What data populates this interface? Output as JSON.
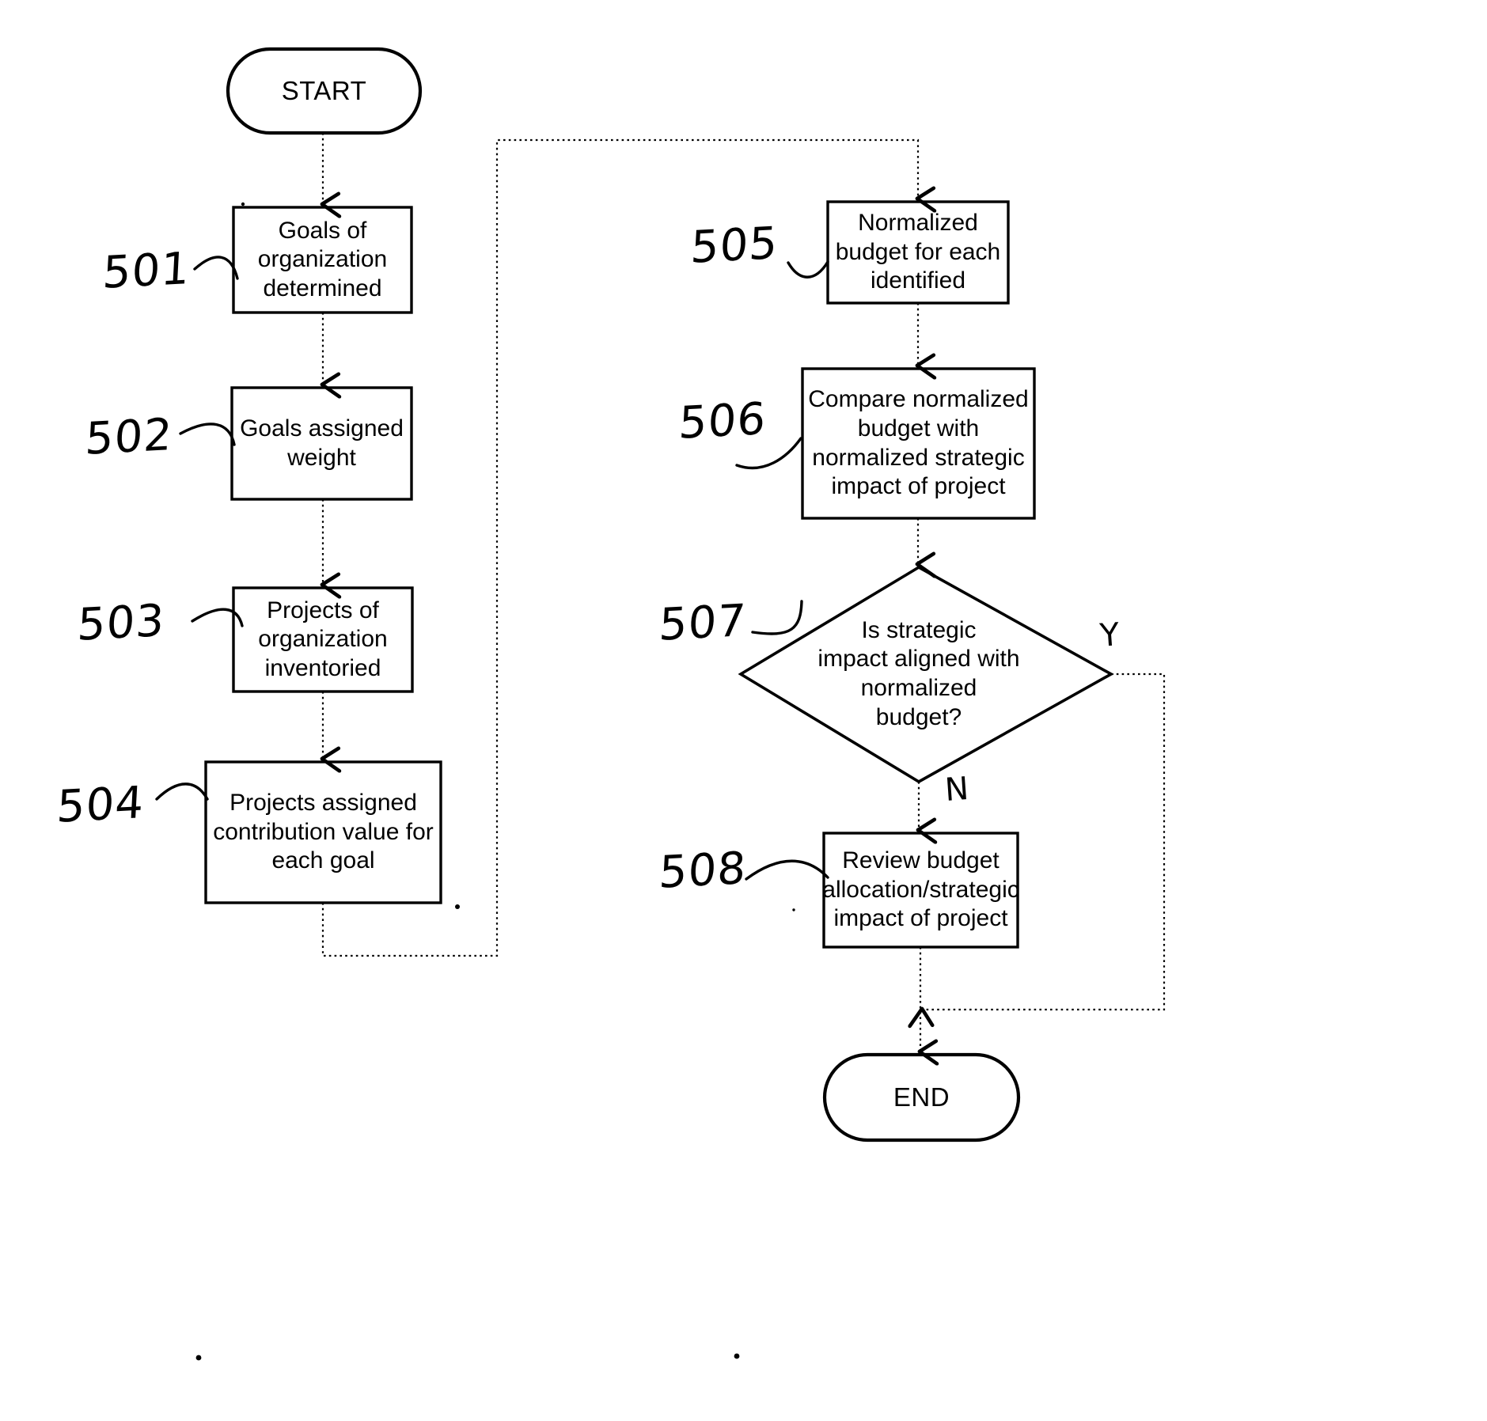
{
  "figure": {
    "type": "flowchart",
    "orientation": "two-column",
    "background_color": "#ffffff",
    "line_color": "#000000"
  },
  "nodes": {
    "start": {
      "label": "START",
      "shape": "terminator"
    },
    "n501": {
      "label": "Goals of\norganization\ndetermined",
      "shape": "process",
      "ref": "501"
    },
    "n502": {
      "label": "Goals assigned\nweight",
      "shape": "process",
      "ref": "502"
    },
    "n503": {
      "label": "Projects of\norganization\ninventoried",
      "shape": "process",
      "ref": "503"
    },
    "n504": {
      "label": "Projects assigned\ncontribution value for\neach goal",
      "shape": "process",
      "ref": "504"
    },
    "n505": {
      "label": "Normalized\nbudget for each\nidentified",
      "shape": "process",
      "ref": "505"
    },
    "n506": {
      "label": "Compare normalized\nbudget with\nnormalized strategic\nimpact of project",
      "shape": "process",
      "ref": "506"
    },
    "n507": {
      "label": "Is strategic\nimpact aligned with\nnormalized\nbudget?",
      "shape": "decision",
      "ref": "507"
    },
    "n508": {
      "label": "Review budget\nallocation/strategic\nimpact of project",
      "shape": "process",
      "ref": "508"
    },
    "end": {
      "label": "END",
      "shape": "terminator"
    }
  },
  "reference_numerals": {
    "r501": "501",
    "r502": "502",
    "r503": "503",
    "r504": "504",
    "r505": "505",
    "r506": "506",
    "r507": "507",
    "r508": "508"
  },
  "branch_labels": {
    "yes": "Y",
    "no": "N"
  },
  "chart_data": {
    "type": "diagram",
    "title": "",
    "nodes": [
      {
        "id": "start",
        "text": "START",
        "shape": "terminator",
        "ref": null
      },
      {
        "id": "501",
        "text": "Goals of organization determined",
        "shape": "process",
        "ref": "501"
      },
      {
        "id": "502",
        "text": "Goals assigned weight",
        "shape": "process",
        "ref": "502"
      },
      {
        "id": "503",
        "text": "Projects of organization inventoried",
        "shape": "process",
        "ref": "503"
      },
      {
        "id": "504",
        "text": "Projects assigned contribution value for each goal",
        "shape": "process",
        "ref": "504"
      },
      {
        "id": "505",
        "text": "Normalized budget for each identified",
        "shape": "process",
        "ref": "505"
      },
      {
        "id": "506",
        "text": "Compare normalized budget with normalized strategic impact of project",
        "shape": "process",
        "ref": "506"
      },
      {
        "id": "507",
        "text": "Is strategic impact aligned with normalized budget?",
        "shape": "decision",
        "ref": "507"
      },
      {
        "id": "508",
        "text": "Review budget allocation/strategic impact of project",
        "shape": "process",
        "ref": "508"
      },
      {
        "id": "end",
        "text": "END",
        "shape": "terminator",
        "ref": null
      }
    ],
    "edges": [
      {
        "from": "start",
        "to": "501",
        "label": ""
      },
      {
        "from": "501",
        "to": "502",
        "label": ""
      },
      {
        "from": "502",
        "to": "503",
        "label": ""
      },
      {
        "from": "503",
        "to": "504",
        "label": ""
      },
      {
        "from": "504",
        "to": "505",
        "label": ""
      },
      {
        "from": "505",
        "to": "506",
        "label": ""
      },
      {
        "from": "506",
        "to": "507",
        "label": ""
      },
      {
        "from": "507",
        "to": "508",
        "label": "N"
      },
      {
        "from": "507",
        "to": "end",
        "label": "Y"
      },
      {
        "from": "508",
        "to": "end",
        "label": ""
      }
    ]
  }
}
